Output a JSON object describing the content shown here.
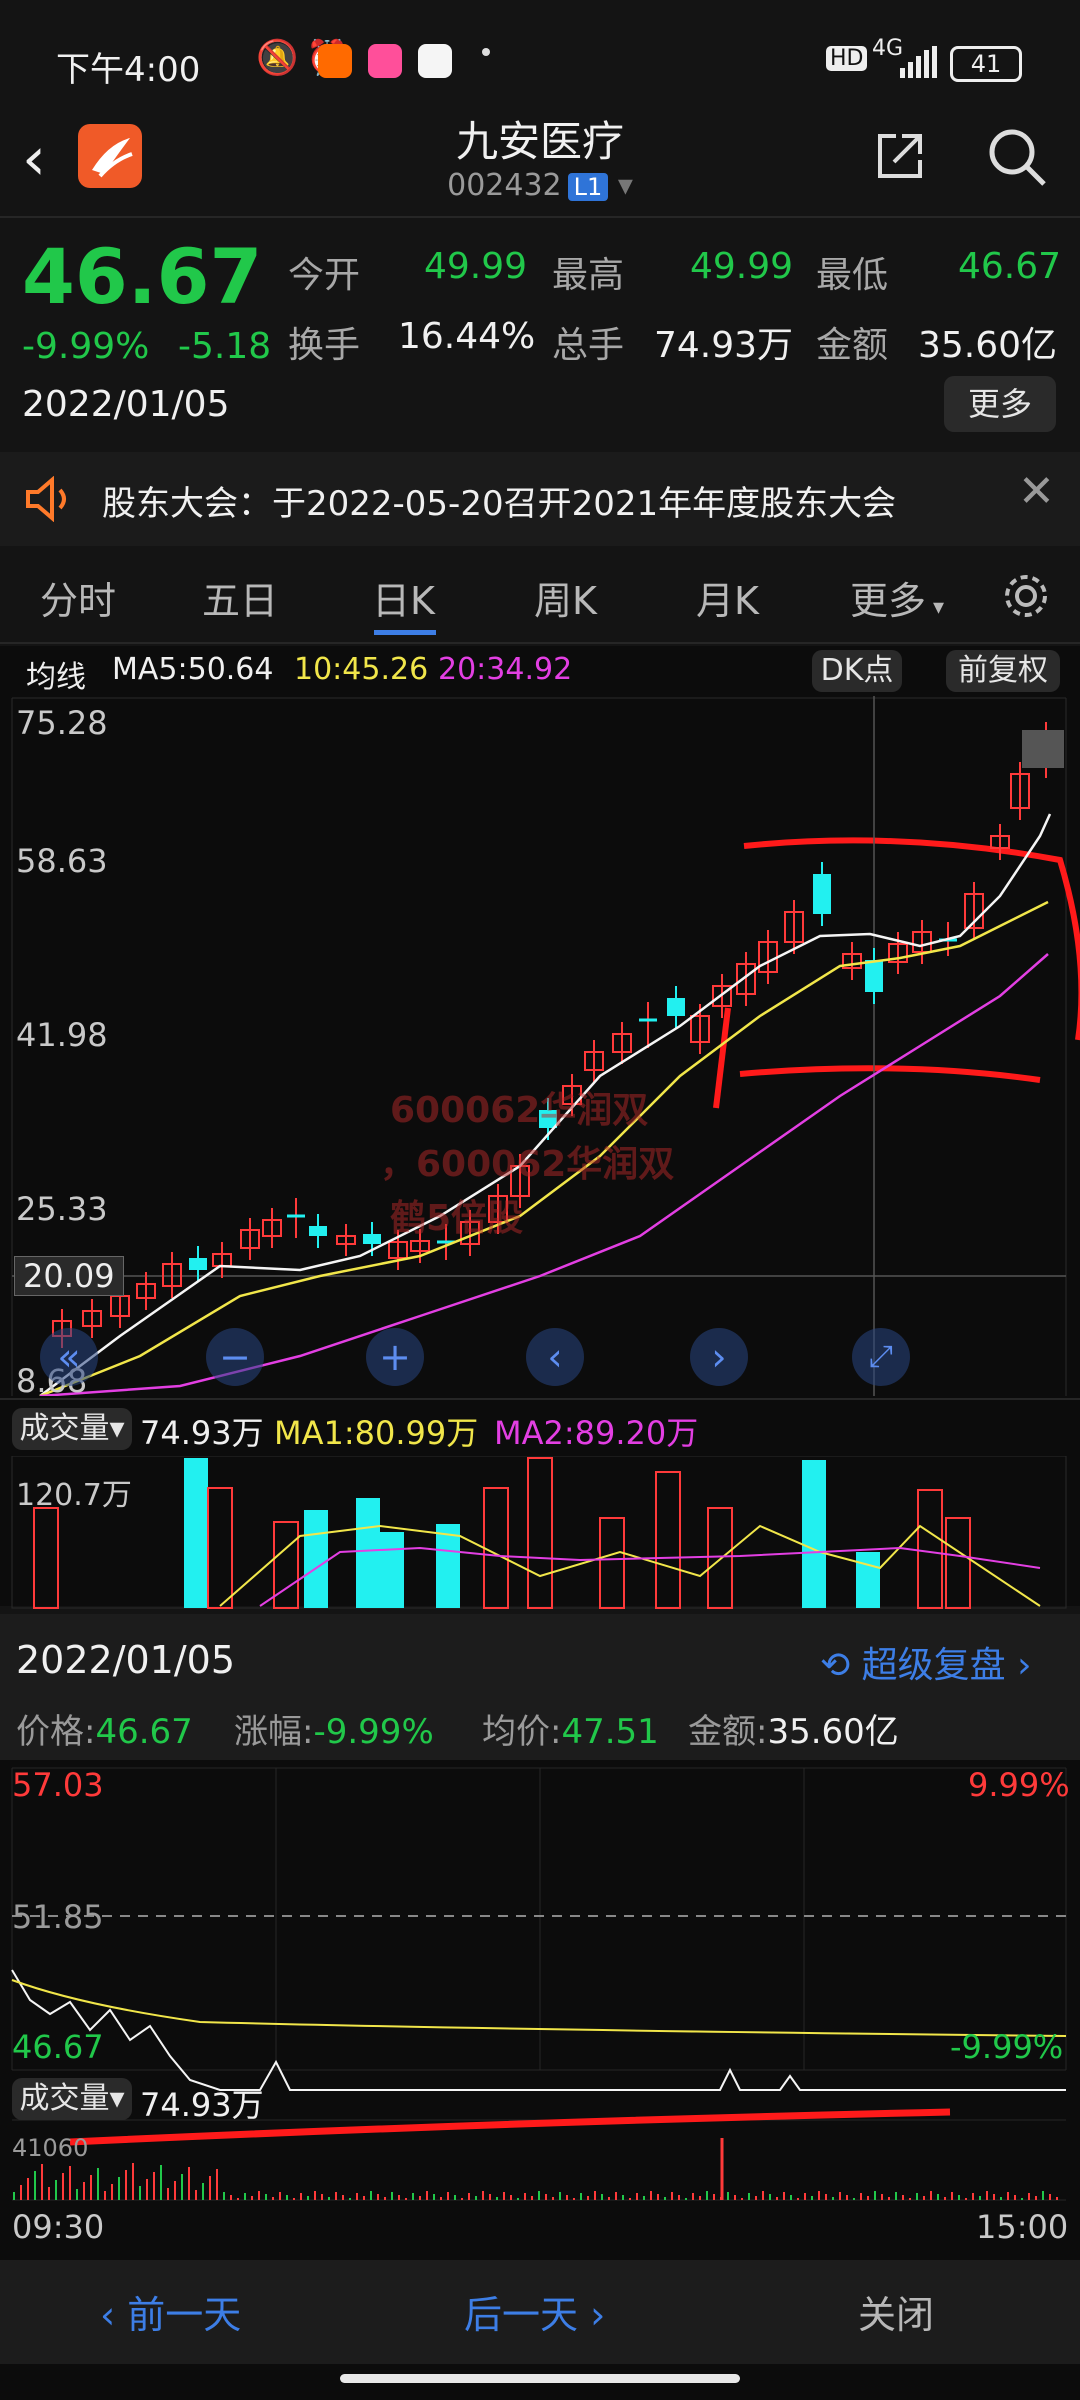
{
  "status_bar": {
    "time": "下午4:00",
    "battery": "41",
    "network": "4G",
    "hd": "HD"
  },
  "header": {
    "title": "九安医疗",
    "code": "002432",
    "level_badge": "L1"
  },
  "quote": {
    "price": "46.67",
    "change_pct": "-9.99%",
    "change": "-5.18",
    "date": "2022/01/05",
    "open_label": "今开",
    "open": "49.99",
    "high_label": "最高",
    "high": "49.99",
    "low_label": "最低",
    "low": "46.67",
    "turnover_label": "换手",
    "turnover": "16.44%",
    "volume_label": "总手",
    "volume": "74.93万",
    "amount_label": "金额",
    "amount": "35.60亿",
    "more_label": "更多"
  },
  "notice": {
    "text": "股东大会：于2022-05-20召开2021年年度股东大会"
  },
  "tabs": [
    "分时",
    "五日",
    "日K",
    "周K",
    "月K",
    "更多"
  ],
  "active_tab": "日K",
  "kline": {
    "ma_label": "均线",
    "ma5": "MA5:50.64",
    "ma10": "10:45.26",
    "ma20": "20:34.92",
    "dk_label": "DK点",
    "adjust_label": "前复权",
    "y_ticks": [
      "75.28",
      "58.63",
      "41.98",
      "25.33",
      "8.68"
    ],
    "crosshair_value": "20.09",
    "watermark": [
      "600062华润双",
      "，600062华润双",
      "鹤5倍股"
    ]
  },
  "volume_panel": {
    "label": "成交量",
    "value": "74.93万",
    "ma1": "MA1:80.99万",
    "ma2": "MA2:89.20万",
    "max": "120.7万"
  },
  "detail": {
    "date": "2022/01/05",
    "replay_label": "超级复盘",
    "price_label": "价格:",
    "price": "46.67",
    "pct_label": "涨幅:",
    "pct": "-9.99%",
    "avg_label": "均价:",
    "avg": "47.51",
    "amount_label": "金额:",
    "amount": "35.60亿"
  },
  "intraday": {
    "top_left": "57.03",
    "top_right": "9.99%",
    "mid": "51.85",
    "bottom_left": "46.67",
    "bottom_right": "-9.99%",
    "vol_label": "成交量",
    "vol_value": "74.93万",
    "vol_max": "41060",
    "time_start": "09:30",
    "time_end": "15:00"
  },
  "bottom_bar": {
    "prev": "前一天",
    "next": "后一天",
    "close": "关闭"
  },
  "colors": {
    "up": "#ff3a3a",
    "down": "#21c84a",
    "accent": "#3d7ee6",
    "cyan": "#22f0f0"
  }
}
